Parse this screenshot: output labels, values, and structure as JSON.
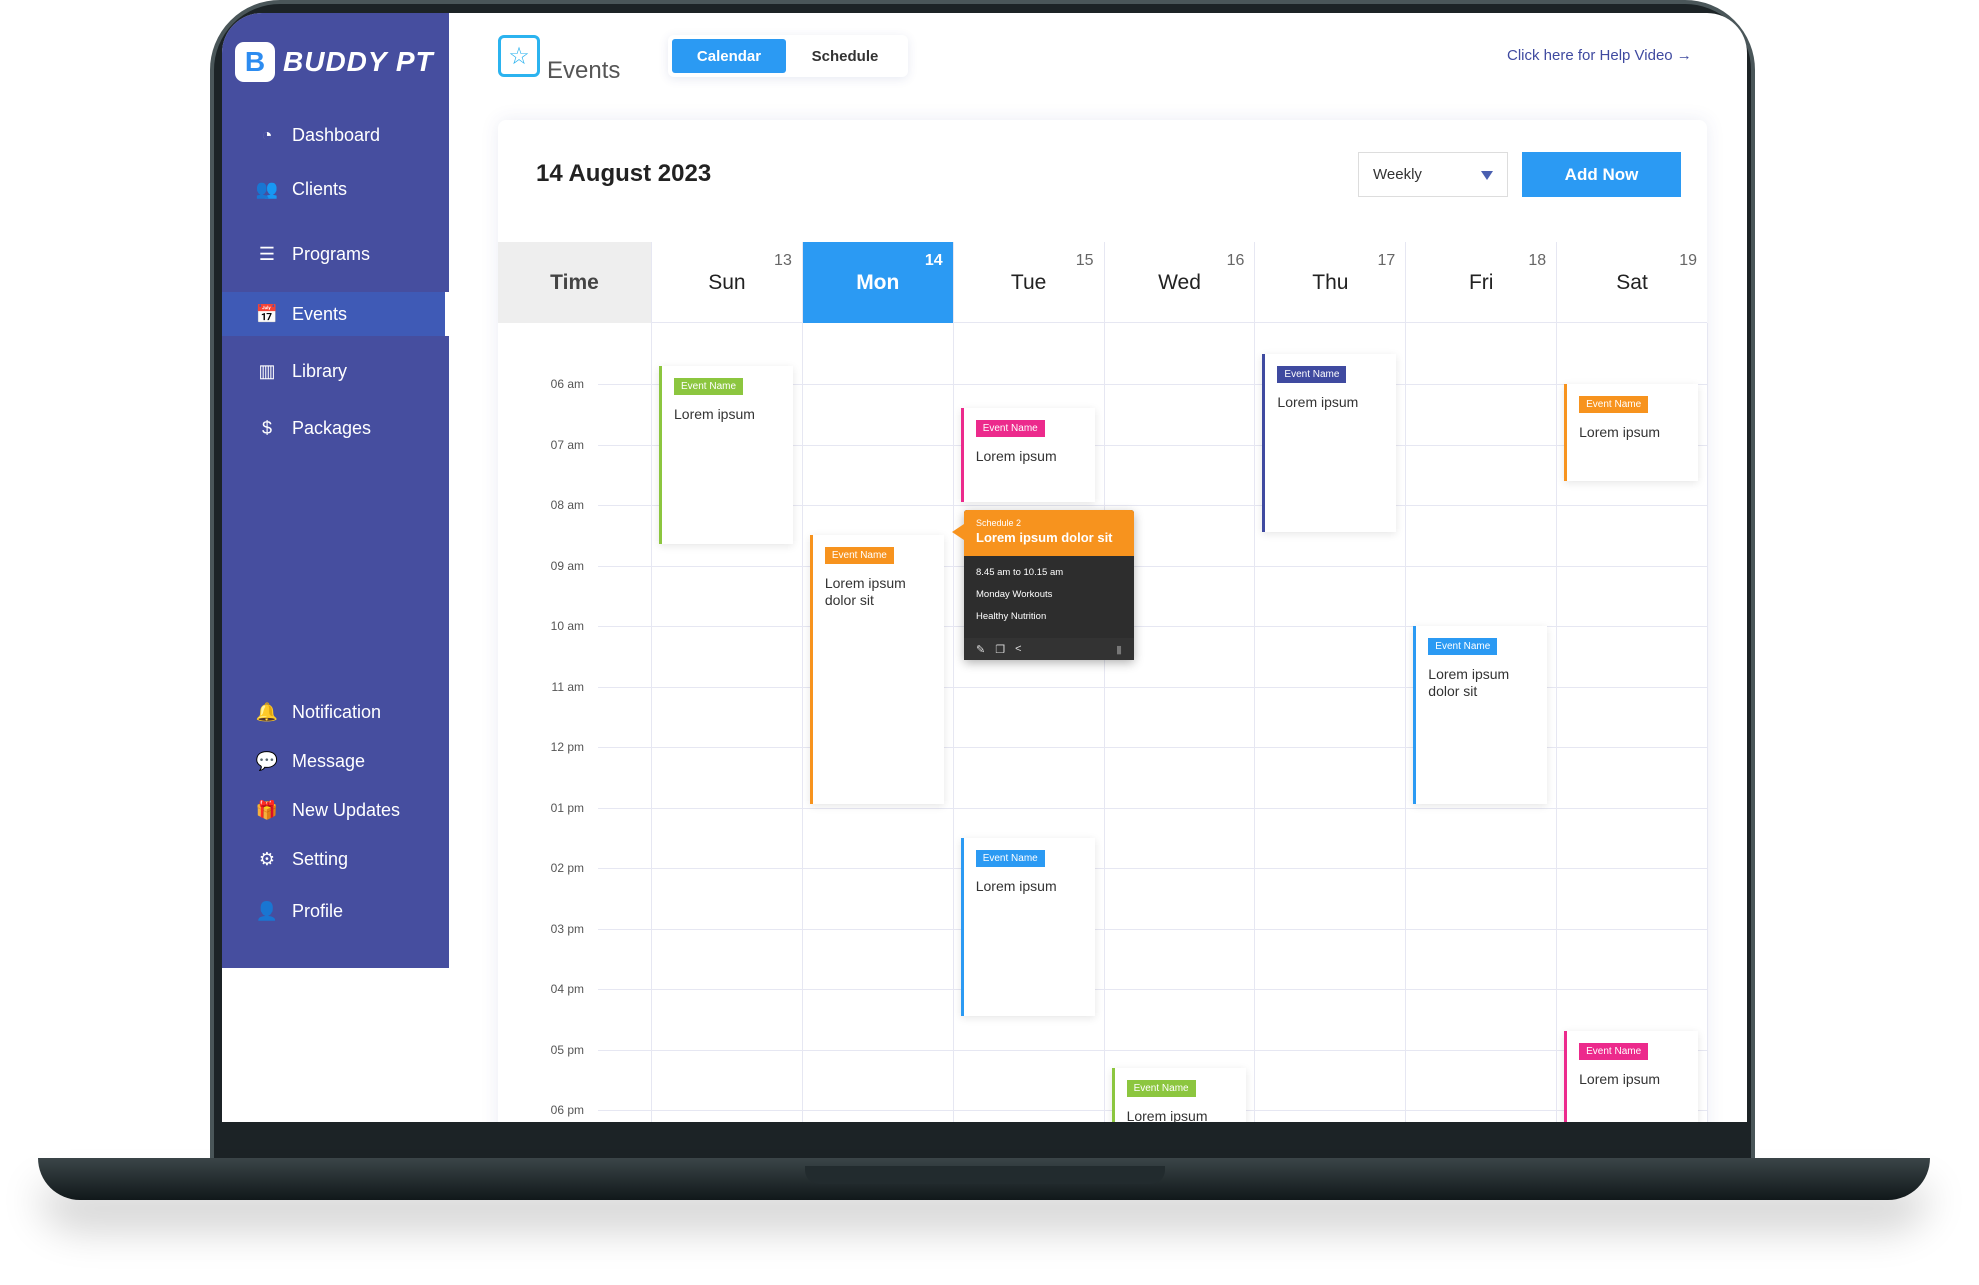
{
  "app": {
    "logo_letter": "B",
    "logo_text": "BUDDY PT"
  },
  "sidebar": {
    "items": [
      {
        "label": "Dashboard",
        "icon": "gauge-icon",
        "glyph": "◔"
      },
      {
        "label": "Clients",
        "icon": "users-icon",
        "glyph": "👥"
      },
      {
        "label": "Programs",
        "icon": "list-icon",
        "glyph": "☰"
      },
      {
        "label": "Events",
        "icon": "calendar-clock-icon",
        "glyph": "📅",
        "active": true
      },
      {
        "label": "Library",
        "icon": "books-icon",
        "glyph": "▥"
      },
      {
        "label": "Packages",
        "icon": "money-box-icon",
        "glyph": "$"
      },
      {
        "label": "Notification",
        "icon": "bell-icon",
        "glyph": "🔔"
      },
      {
        "label": "Message",
        "icon": "chat-icon",
        "glyph": "💬"
      },
      {
        "label": "New Updates",
        "icon": "gift-icon",
        "glyph": "🎁"
      },
      {
        "label": "Setting",
        "icon": "gear-icon",
        "glyph": "⚙"
      },
      {
        "label": "Profile",
        "icon": "user-circle-icon",
        "glyph": "👤"
      }
    ]
  },
  "header": {
    "title": "Events",
    "tabs": [
      {
        "label": "Calendar",
        "active": true
      },
      {
        "label": "Schedule"
      }
    ],
    "help": "Click here for Help Video →"
  },
  "calendar": {
    "date": "14 August 2023",
    "view": "Weekly",
    "add_label": "Add Now",
    "time_label": "Time",
    "days": [
      {
        "name": "Sun",
        "num": "13"
      },
      {
        "name": "Mon",
        "num": "14",
        "active": true
      },
      {
        "name": "Tue",
        "num": "15"
      },
      {
        "name": "Wed",
        "num": "16"
      },
      {
        "name": "Thu",
        "num": "17"
      },
      {
        "name": "Fri",
        "num": "18"
      },
      {
        "name": "Sat",
        "num": "19"
      }
    ],
    "hours": [
      "06 am",
      "07 am",
      "08 am",
      "09 am",
      "10 am",
      "11 am",
      "12 pm",
      "01 pm",
      "02 pm",
      "03 pm",
      "04 pm",
      "05 pm",
      "06 pm"
    ],
    "events": [
      {
        "day": 0,
        "start": 5.7,
        "end": 8.65,
        "label": "Event Name",
        "text": "Lorem ipsum",
        "color": "#8cc63f"
      },
      {
        "day": 1,
        "start": 8.5,
        "end": 12.95,
        "label": "Event Name",
        "text": "Lorem ipsum dolor sit",
        "color": "#f7931e"
      },
      {
        "day": 2,
        "start": 6.4,
        "end": 7.95,
        "label": "Event Name",
        "text": "Lorem ipsum",
        "color": "#ec2a8c"
      },
      {
        "day": 2,
        "start": 13.5,
        "end": 16.45,
        "label": "Event Name",
        "text": "Lorem ipsum",
        "color": "#2b9af3"
      },
      {
        "day": 3,
        "start": 17.3,
        "end": 20,
        "label": "Event Name",
        "text": "Lorem ipsum",
        "color": "#8cc63f"
      },
      {
        "day": 4,
        "start": 5.5,
        "end": 8.45,
        "label": "Event Name",
        "text": "Lorem ipsum",
        "color": "#3f4aa0"
      },
      {
        "day": 5,
        "start": 10,
        "end": 12.95,
        "label": "Event Name",
        "text": "Lorem ipsum dolor sit",
        "color": "#2b9af3"
      },
      {
        "day": 6,
        "start": 6.0,
        "end": 7.6,
        "label": "Event Name",
        "text": "Lorem ipsum",
        "color": "#f7931e"
      },
      {
        "day": 6,
        "start": 16.7,
        "end": 20,
        "label": "Event Name",
        "text": "Lorem ipsum",
        "color": "#ec2a8c"
      }
    ],
    "popup": {
      "subtitle": "Schedule 2",
      "title": "Lorem ipsum dolor sit",
      "time": "8.45 am to 10.15 am",
      "lines": [
        "Monday Workouts",
        "Healthy Nutrition"
      ]
    }
  }
}
